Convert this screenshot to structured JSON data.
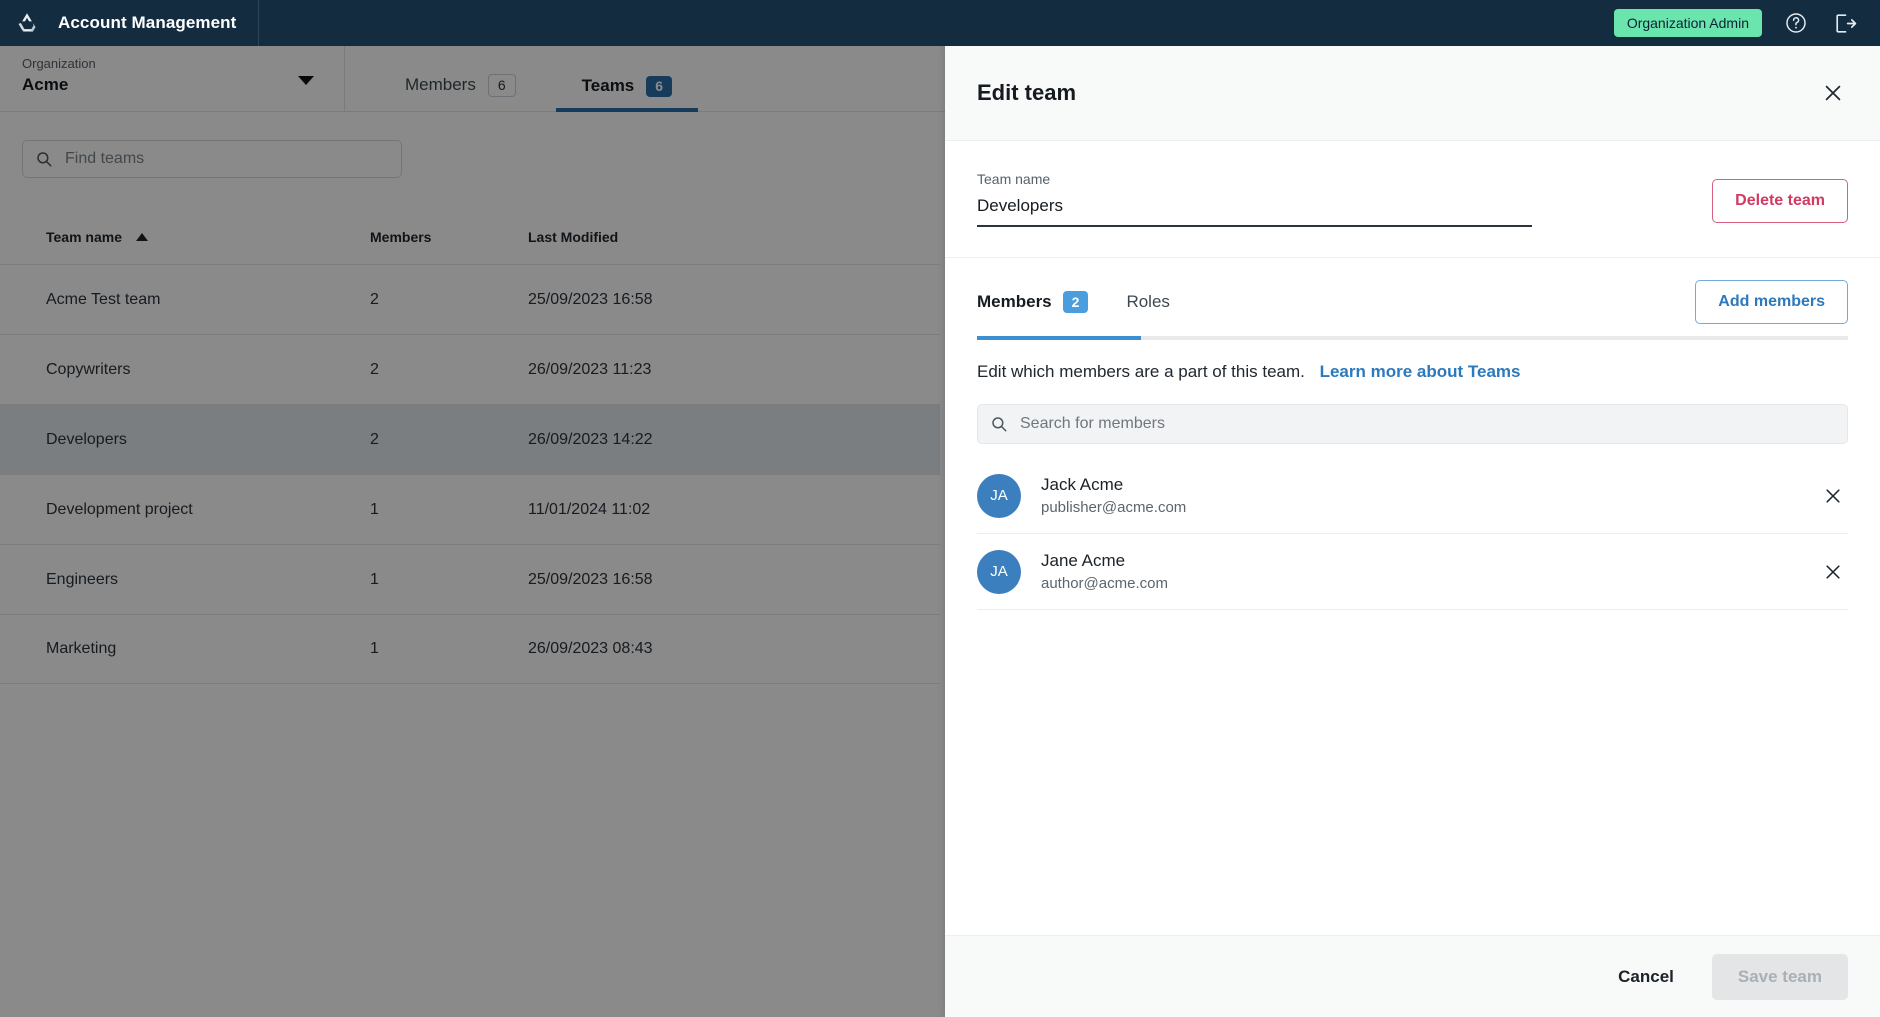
{
  "topbar": {
    "brand_title": "Account Management",
    "role_badge": "Organization Admin",
    "help_icon": "question-circle-icon",
    "logout_icon": "logout-icon",
    "bg_color": "#132c40",
    "badge_color": "#6ae5ae"
  },
  "org": {
    "label": "Organization",
    "value": "Acme"
  },
  "tabs": [
    {
      "label": "Members",
      "count": "6",
      "active": false
    },
    {
      "label": "Teams",
      "count": "6",
      "active": true
    }
  ],
  "search": {
    "placeholder": "Find teams",
    "icon": "search-icon"
  },
  "table": {
    "columns": [
      "Team name",
      "Members",
      "Last Modified"
    ],
    "sort_column": "Team name",
    "sort_direction": "asc",
    "rows": [
      {
        "name": "Acme Test team",
        "members": "2",
        "modified": "25/09/2023 16:58",
        "selected": false
      },
      {
        "name": "Copywriters",
        "members": "2",
        "modified": "26/09/2023 11:23",
        "selected": false
      },
      {
        "name": "Developers",
        "members": "2",
        "modified": "26/09/2023 14:22",
        "selected": true
      },
      {
        "name": "Development project",
        "members": "1",
        "modified": "11/01/2024 11:02",
        "selected": false
      },
      {
        "name": "Engineers",
        "members": "1",
        "modified": "25/09/2023 16:58",
        "selected": false
      },
      {
        "name": "Marketing",
        "members": "1",
        "modified": "26/09/2023 08:43",
        "selected": false
      }
    ]
  },
  "panel": {
    "title": "Edit team",
    "close_icon": "close-icon",
    "team_name_label": "Team name",
    "team_name_value": "Developers",
    "delete_label": "Delete team",
    "delete_color": "#d23a63",
    "sub_tabs": [
      {
        "label": "Members",
        "count": "2",
        "active": true
      },
      {
        "label": "Roles",
        "count": "",
        "active": false
      }
    ],
    "add_members_label": "Add members",
    "accent_color": "#2c79bd",
    "description": "Edit which members are a part of this team.",
    "description_link": "Learn more about Teams",
    "member_search_placeholder": "Search for members",
    "member_search_icon": "search-icon",
    "members": [
      {
        "initials": "JA",
        "name": "Jack Acme",
        "email": "publisher@acme.com",
        "remove_icon": "close-icon"
      },
      {
        "initials": "JA",
        "name": "Jane Acme",
        "email": "author@acme.com",
        "remove_icon": "close-icon"
      }
    ],
    "cancel_label": "Cancel",
    "save_label": "Save team",
    "save_disabled": true
  }
}
